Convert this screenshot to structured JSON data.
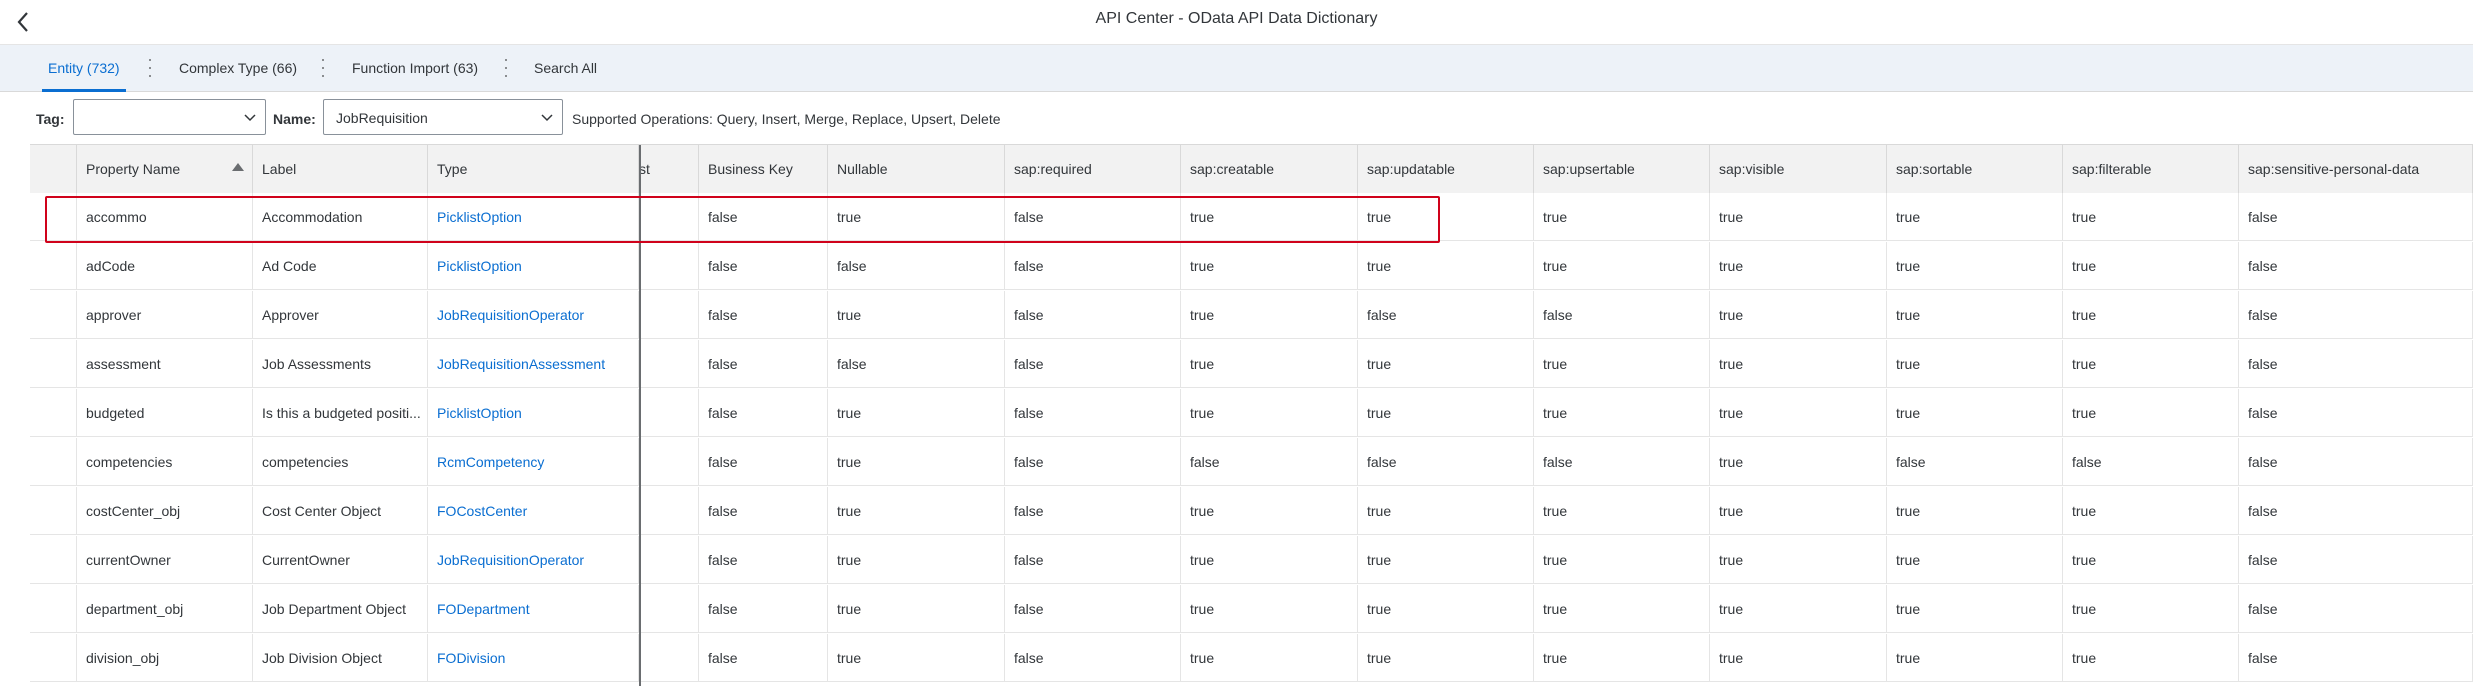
{
  "header": {
    "title": "API Center - OData API Data Dictionary",
    "back_icon": "chevron-left-icon"
  },
  "tabs": [
    {
      "label": "Entity (732)",
      "selected": true
    },
    {
      "label": "Complex Type (66)",
      "selected": false
    },
    {
      "label": "Function Import (63)",
      "selected": false
    },
    {
      "label": "Search All",
      "selected": false
    }
  ],
  "filters": {
    "tag_label": "Tag:",
    "tag_value": "",
    "name_label": "Name:",
    "name_value": "JobRequisition",
    "supported_operations": "Supported Operations: Query, Insert, Merge, Replace, Upsert, Delete"
  },
  "table": {
    "columns": [
      "Property Name",
      "Label",
      "Type",
      "st",
      "Business Key",
      "Nullable",
      "sap:required",
      "sap:creatable",
      "sap:updatable",
      "sap:upsertable",
      "sap:visible",
      "sap:sortable",
      "sap:filterable",
      "sap:sensitive-personal-data"
    ],
    "sort_icon": "sort-ascending-icon",
    "rows": [
      [
        "accommo",
        "Accommodation",
        "PicklistOption",
        "",
        "false",
        "true",
        "false",
        "true",
        "true",
        "true",
        "true",
        "true",
        "true",
        "false"
      ],
      [
        "adCode",
        "Ad Code",
        "PicklistOption",
        "",
        "false",
        "false",
        "false",
        "true",
        "true",
        "true",
        "true",
        "true",
        "true",
        "false"
      ],
      [
        "approver",
        "Approver",
        "JobRequisitionOperator",
        "",
        "false",
        "true",
        "false",
        "true",
        "false",
        "false",
        "true",
        "true",
        "true",
        "false"
      ],
      [
        "assessment",
        "Job Assessments",
        "JobRequisitionAssessment",
        "",
        "false",
        "false",
        "false",
        "true",
        "true",
        "true",
        "true",
        "true",
        "true",
        "false"
      ],
      [
        "budgeted",
        "Is this a budgeted positi...",
        "PicklistOption",
        "",
        "false",
        "true",
        "false",
        "true",
        "true",
        "true",
        "true",
        "true",
        "true",
        "false"
      ],
      [
        "competencies",
        "competencies",
        "RcmCompetency",
        "",
        "false",
        "true",
        "false",
        "false",
        "false",
        "false",
        "true",
        "false",
        "false",
        "false"
      ],
      [
        "costCenter_obj",
        "Cost Center Object",
        "FOCostCenter",
        "",
        "false",
        "true",
        "false",
        "true",
        "true",
        "true",
        "true",
        "true",
        "true",
        "false"
      ],
      [
        "currentOwner",
        "CurrentOwner",
        "JobRequisitionOperator",
        "",
        "false",
        "true",
        "false",
        "true",
        "true",
        "true",
        "true",
        "true",
        "true",
        "false"
      ],
      [
        "department_obj",
        "Job Department Object",
        "FODepartment",
        "",
        "false",
        "true",
        "false",
        "true",
        "true",
        "true",
        "true",
        "true",
        "true",
        "false"
      ],
      [
        "division_obj",
        "Job Division Object",
        "FODivision",
        "",
        "false",
        "true",
        "false",
        "true",
        "true",
        "true",
        "true",
        "true",
        "true",
        "false"
      ]
    ]
  },
  "colors": {
    "accent": "#0a6ed1",
    "highlight": "#d0021b",
    "tabbar": "#edf2f8"
  }
}
